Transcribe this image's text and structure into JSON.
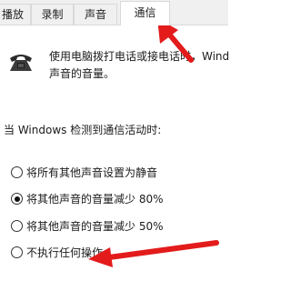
{
  "tabs": [
    {
      "label": "播放"
    },
    {
      "label": "录制"
    },
    {
      "label": "声音"
    },
    {
      "label": "通信",
      "active": true
    }
  ],
  "description": {
    "line1": "使用电脑拨打电话或接电话时，Wind",
    "line2": "声音的音量。"
  },
  "prompt": "当 Windows 检测到通信活动时:",
  "options": [
    {
      "label": "将所有其他声音设置为静音",
      "checked": false
    },
    {
      "label": "将其他声音的音量减少 80%",
      "checked": true
    },
    {
      "label": "将其他声音的音量减少 50%",
      "checked": false
    },
    {
      "label": "不执行任何操作",
      "checked": false
    }
  ],
  "annotation_color": "#e31b1b",
  "icon": "telephone-icon"
}
